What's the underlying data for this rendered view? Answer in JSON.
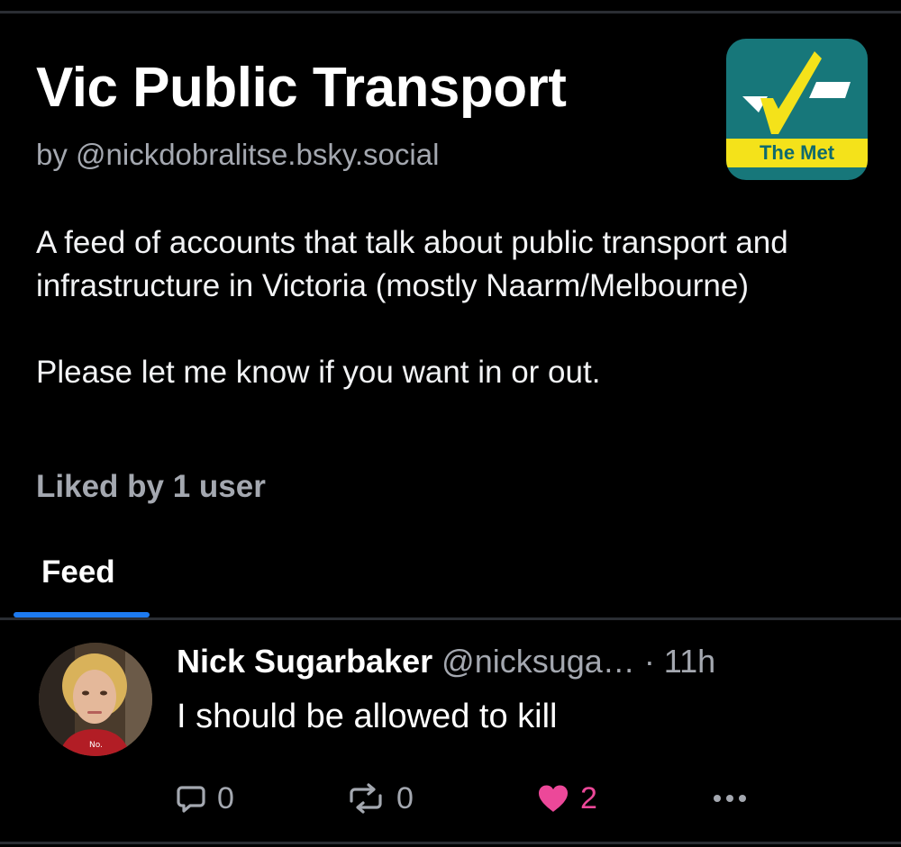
{
  "feed": {
    "title": "Vic Public Transport",
    "author_line": "by @nickdobralitse.bsky.social",
    "avatar_label": "The Met",
    "description_paragraphs": [
      "A feed of accounts that talk about public transport and infrastructure in Victoria (mostly Naarm/Melbourne)",
      "Please let me know if you want in or out."
    ],
    "liked_by": "Liked by 1 user"
  },
  "tabs": {
    "active_label": "Feed"
  },
  "post": {
    "display_name": "Nick Sugarbaker",
    "handle": "@nicksuga…",
    "time": "· 11h",
    "text": "I should be allowed to kill",
    "avatar_caption": "No.",
    "actions": {
      "reply_count": "0",
      "repost_count": "0",
      "like_count": "2",
      "more_icon": "ellipsis-icon"
    }
  },
  "colors": {
    "background": "#000000",
    "text_primary": "#ffffff",
    "text_secondary": "#a4a8b0",
    "accent_blue": "#1d7af0",
    "like_pink": "#ec4899",
    "met_teal": "#17777a",
    "met_yellow": "#f4e21a"
  }
}
